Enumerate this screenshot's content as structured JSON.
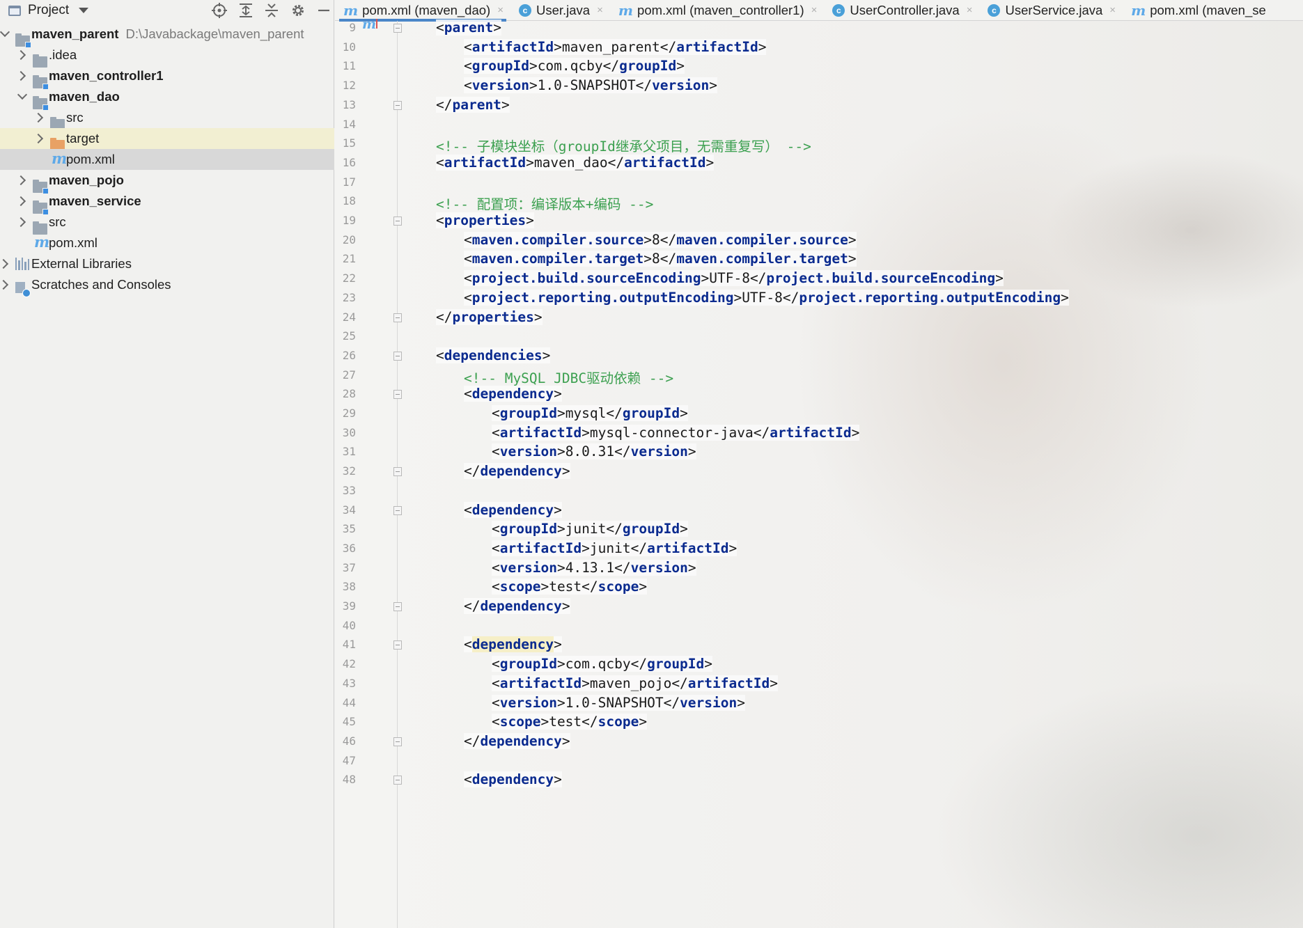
{
  "project_panel": {
    "title": "Project",
    "tree": [
      {
        "label": "maven_parent",
        "hint": "D:\\Javabackage\\maven_parent",
        "depth": 0,
        "expanded": true,
        "icon": "module-folder-icon",
        "bold": true
      },
      {
        "label": ".idea",
        "depth": 1,
        "expanded": false,
        "icon": "folder-icon",
        "bold": false
      },
      {
        "label": "maven_controller1",
        "depth": 1,
        "expanded": false,
        "icon": "module-folder-icon",
        "bold": true
      },
      {
        "label": "maven_dao",
        "depth": 1,
        "expanded": true,
        "icon": "module-folder-icon",
        "bold": true
      },
      {
        "label": "src",
        "depth": 2,
        "expanded": false,
        "icon": "folder-icon",
        "bold": false
      },
      {
        "label": "target",
        "depth": 2,
        "expanded": false,
        "icon": "excluded-folder-icon",
        "bold": false,
        "state": "selected"
      },
      {
        "label": "pom.xml",
        "depth": 2,
        "icon": "maven-file-icon",
        "bold": false,
        "state": "current"
      },
      {
        "label": "maven_pojo",
        "depth": 1,
        "expanded": false,
        "icon": "module-folder-icon",
        "bold": true
      },
      {
        "label": "maven_service",
        "depth": 1,
        "expanded": false,
        "icon": "module-folder-icon",
        "bold": true
      },
      {
        "label": "src",
        "depth": 1,
        "expanded": false,
        "icon": "folder-icon",
        "bold": false
      },
      {
        "label": "pom.xml",
        "depth": 1,
        "icon": "maven-file-icon",
        "bold": false
      },
      {
        "label": "External Libraries",
        "depth": 0,
        "expanded": false,
        "icon": "libraries-icon",
        "bold": false
      },
      {
        "label": "Scratches and Consoles",
        "depth": 0,
        "expanded": false,
        "icon": "scratches-icon",
        "bold": false
      }
    ]
  },
  "tabs": [
    {
      "label": "pom.xml (maven_dao)",
      "icon": "maven-file-icon",
      "active": true
    },
    {
      "label": "User.java",
      "icon": "java-class-icon",
      "active": false
    },
    {
      "label": "pom.xml (maven_controller1)",
      "icon": "maven-file-icon",
      "active": false
    },
    {
      "label": "UserController.java",
      "icon": "java-class-icon",
      "active": false
    },
    {
      "label": "UserService.java",
      "icon": "java-class-icon",
      "active": false
    },
    {
      "label": "pom.xml (maven_se",
      "icon": "maven-file-icon",
      "active": false
    }
  ],
  "editor": {
    "lines": [
      {
        "n": "9",
        "indent": 1,
        "kind": "tag",
        "text": "<parent>",
        "fold": true,
        "marker": true
      },
      {
        "n": "10",
        "indent": 2,
        "kind": "elem",
        "tag": "artifactId",
        "value": "maven_parent"
      },
      {
        "n": "11",
        "indent": 2,
        "kind": "elem",
        "tag": "groupId",
        "value": "com.qcby"
      },
      {
        "n": "12",
        "indent": 2,
        "kind": "elem",
        "tag": "version",
        "value": "1.0-SNAPSHOT"
      },
      {
        "n": "13",
        "indent": 1,
        "kind": "tag",
        "text": "</parent>",
        "fold": true
      },
      {
        "n": "14",
        "indent": 0,
        "kind": "blank"
      },
      {
        "n": "15",
        "indent": 1,
        "kind": "comment",
        "text": "<!-- 子模块坐标（groupId继承父项目，无需重复写） -->"
      },
      {
        "n": "16",
        "indent": 1,
        "kind": "elem",
        "tag": "artifactId",
        "value": "maven_dao"
      },
      {
        "n": "17",
        "indent": 0,
        "kind": "blank"
      },
      {
        "n": "18",
        "indent": 1,
        "kind": "comment",
        "text": "<!-- 配置项：编译版本+编码 -->"
      },
      {
        "n": "19",
        "indent": 1,
        "kind": "tag",
        "text": "<properties>",
        "fold": true
      },
      {
        "n": "20",
        "indent": 2,
        "kind": "elem",
        "tag": "maven.compiler.source",
        "value": "8"
      },
      {
        "n": "21",
        "indent": 2,
        "kind": "elem",
        "tag": "maven.compiler.target",
        "value": "8"
      },
      {
        "n": "22",
        "indent": 2,
        "kind": "elem",
        "tag": "project.build.sourceEncoding",
        "value": "UTF-8"
      },
      {
        "n": "23",
        "indent": 2,
        "kind": "elem",
        "tag": "project.reporting.outputEncoding",
        "value": "UTF-8"
      },
      {
        "n": "24",
        "indent": 1,
        "kind": "tag",
        "text": "</properties>",
        "fold": true
      },
      {
        "n": "25",
        "indent": 0,
        "kind": "blank"
      },
      {
        "n": "26",
        "indent": 1,
        "kind": "tag",
        "text": "<dependencies>",
        "fold": true
      },
      {
        "n": "27",
        "indent": 2,
        "kind": "comment",
        "text": "<!-- MySQL JDBC驱动依赖 -->"
      },
      {
        "n": "28",
        "indent": 2,
        "kind": "tag",
        "text": "<dependency>",
        "fold": true
      },
      {
        "n": "29",
        "indent": 3,
        "kind": "elem",
        "tag": "groupId",
        "value": "mysql"
      },
      {
        "n": "30",
        "indent": 3,
        "kind": "elem",
        "tag": "artifactId",
        "value": "mysql-connector-java"
      },
      {
        "n": "31",
        "indent": 3,
        "kind": "elem",
        "tag": "version",
        "value": "8.0.31"
      },
      {
        "n": "32",
        "indent": 2,
        "kind": "tag",
        "text": "</dependency>",
        "fold": true
      },
      {
        "n": "33",
        "indent": 0,
        "kind": "blank"
      },
      {
        "n": "34",
        "indent": 2,
        "kind": "tag",
        "text": "<dependency>",
        "fold": true
      },
      {
        "n": "35",
        "indent": 3,
        "kind": "elem",
        "tag": "groupId",
        "value": "junit"
      },
      {
        "n": "36",
        "indent": 3,
        "kind": "elem",
        "tag": "artifactId",
        "value": "junit"
      },
      {
        "n": "37",
        "indent": 3,
        "kind": "elem",
        "tag": "version",
        "value": "4.13.1"
      },
      {
        "n": "38",
        "indent": 3,
        "kind": "elem",
        "tag": "scope",
        "value": "test"
      },
      {
        "n": "39",
        "indent": 2,
        "kind": "tag",
        "text": "</dependency>",
        "fold": true
      },
      {
        "n": "40",
        "indent": 0,
        "kind": "blank"
      },
      {
        "n": "41",
        "indent": 2,
        "kind": "tag",
        "text": "<dependency>",
        "fold": true,
        "highlight": true
      },
      {
        "n": "42",
        "indent": 3,
        "kind": "elem",
        "tag": "groupId",
        "value": "com.qcby"
      },
      {
        "n": "43",
        "indent": 3,
        "kind": "elem",
        "tag": "artifactId",
        "value": "maven_pojo"
      },
      {
        "n": "44",
        "indent": 3,
        "kind": "elem",
        "tag": "version",
        "value": "1.0-SNAPSHOT"
      },
      {
        "n": "45",
        "indent": 3,
        "kind": "elem",
        "tag": "scope",
        "value": "test"
      },
      {
        "n": "46",
        "indent": 2,
        "kind": "tag",
        "text": "</dependency>",
        "fold": true
      },
      {
        "n": "47",
        "indent": 0,
        "kind": "blank"
      },
      {
        "n": "48",
        "indent": 2,
        "kind": "tag",
        "text": "<dependency>",
        "fold": true
      }
    ]
  }
}
